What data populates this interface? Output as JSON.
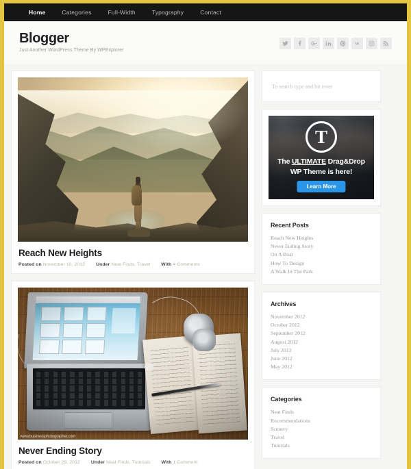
{
  "theme": {
    "frame_color": "#e3c63f",
    "navbar_color": "#161616",
    "page_bg": "#f5f5f3",
    "accent_color": "#2b95e8"
  },
  "nav": {
    "items": [
      {
        "label": "Home",
        "active": true
      },
      {
        "label": "Categories",
        "active": false
      },
      {
        "label": "Full-Width",
        "active": false
      },
      {
        "label": "Typography",
        "active": false
      },
      {
        "label": "Contact",
        "active": false
      }
    ]
  },
  "header": {
    "site_title": "Blogger",
    "tagline": "Just Another WordPress Theme By WPExplorer",
    "social": [
      {
        "name": "twitter-icon"
      },
      {
        "name": "facebook-icon"
      },
      {
        "name": "google-plus-icon"
      },
      {
        "name": "linkedin-icon"
      },
      {
        "name": "pinterest-icon"
      },
      {
        "name": "vk-icon"
      },
      {
        "name": "instagram-icon"
      },
      {
        "name": "rss-icon"
      }
    ]
  },
  "posts": [
    {
      "title": "Reach New Heights",
      "image_alt": "Hiker with backpack standing on a rocky mountain ridge at sunrise",
      "meta": {
        "posted_label": "Posted on",
        "date": "November 10, 2012",
        "under_label": "Under",
        "categories": "Neat Finds, Travel",
        "with_label": "With",
        "comments": "4 Comments"
      }
    },
    {
      "title": "Never Ending Story",
      "image_alt": "Laptop on a wooden desk beside an open notebook, pen, earbuds and a watch",
      "image_watermark": "www.businessphotographer.com",
      "meta": {
        "posted_label": "Posted on",
        "date": "October 28, 2012",
        "under_label": "Under",
        "categories": "Neat Finds, Tutorials",
        "with_label": "With",
        "comments": "1 Comment"
      }
    }
  ],
  "sidebar": {
    "search": {
      "placeholder": "To search type and hit enter",
      "value": ""
    },
    "ad": {
      "logo_letter": "T",
      "line1_prefix": "The ",
      "line1_emphasis": "ULTIMATE",
      "line1_suffix": " Drag&Drop",
      "line2": "WP Theme is here!",
      "cta_label": "Learn More"
    },
    "widgets": [
      {
        "title": "Recent Posts",
        "items": [
          "Reach New Heights",
          "Never Ending Story",
          "On A Boat",
          "How To Design",
          "A Walk In The Park"
        ]
      },
      {
        "title": "Archives",
        "items": [
          "November 2012",
          "October 2012",
          "September 2012",
          "August 2012",
          "July 2012",
          "June 2012",
          "May 2012"
        ]
      },
      {
        "title": "Categories",
        "items": [
          "Neat Finds",
          "Recommendations",
          "Scenery",
          "Travel",
          "Tutorials"
        ]
      }
    ]
  }
}
